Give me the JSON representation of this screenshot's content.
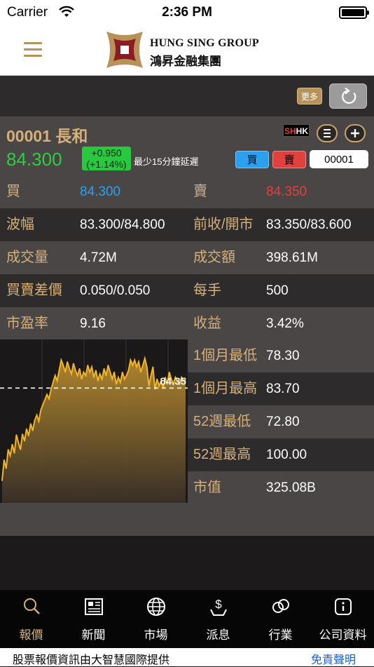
{
  "status_bar": {
    "carrier": "Carrier",
    "time": "2:36 PM"
  },
  "header": {
    "brand_en": "HUNG SING GROUP",
    "brand_zh": "鴻昇金融集團"
  },
  "toolbar": {
    "more_label": "更多"
  },
  "quote": {
    "code_name": "00001  長和",
    "price": "84.300",
    "change": "+0.950",
    "change_pct": "(+1.14%)",
    "delay_note": "最少15分鐘延遲",
    "shhk_badge": "SHHK",
    "buy_label": "買",
    "sell_label": "賣",
    "code_value": "00001",
    "price_color": "#2ecc40",
    "change_bg": "#27c93f"
  },
  "stats": {
    "rows": [
      {
        "label_l": "買",
        "value_l": "84.300",
        "label_r": "賣",
        "value_r": "84.350"
      },
      {
        "label_l": "波幅",
        "value_l": "83.300/84.800",
        "label_r": "前收/開市",
        "value_r": "83.350/83.600"
      },
      {
        "label_l": "成交量",
        "value_l": "4.72M",
        "label_r": "成交額",
        "value_r": "398.61M"
      },
      {
        "label_l": "買賣差價",
        "value_l": "0.050/0.050",
        "label_r": "每手",
        "value_r": "500"
      },
      {
        "label_l": "市盈率",
        "value_l": "9.16",
        "label_r": "收益",
        "value_r": "3.42%"
      }
    ],
    "buy_color": "#2aa0ef",
    "sell_color": "#e0403e",
    "side": [
      {
        "label": "1個月最低",
        "value": "78.30"
      },
      {
        "label": "1個月最高",
        "value": "83.70"
      },
      {
        "label": "52週最低",
        "value": "72.80"
      },
      {
        "label": "52週最高",
        "value": "100.00"
      },
      {
        "label": "市值",
        "value": "325.08B"
      }
    ]
  },
  "chart_data": {
    "type": "area",
    "ref_label": "84.35",
    "line_color": "#f0b429",
    "values": [
      73.6,
      76.0,
      75.0,
      77.2,
      76.5,
      77.8,
      76.8,
      78.9,
      78.0,
      77.2,
      79.0,
      78.2,
      79.6,
      78.8,
      80.2,
      79.4,
      80.6,
      81.2,
      80.5,
      81.8,
      82.4,
      83.0,
      83.6,
      83.1,
      84.2,
      85.0,
      85.8,
      85.2,
      86.4,
      87.6,
      87.0,
      86.2,
      87.4,
      86.6,
      86.0,
      87.2,
      86.4,
      85.8,
      86.6,
      85.4,
      86.2,
      85.8,
      87.0,
      86.2,
      86.8,
      85.6,
      86.4,
      85.2,
      86.0,
      85.4,
      86.6,
      85.8,
      87.0,
      86.2,
      85.4,
      86.2,
      84.8,
      85.6,
      85.0,
      86.2,
      85.4,
      85.8,
      86.4,
      87.6,
      87.0,
      87.6,
      86.8,
      87.4,
      86.2,
      87.0,
      87.8,
      86.8,
      84.6,
      85.8,
      86.8,
      84.2,
      85.4,
      84.6,
      85.2,
      84.4,
      85.6,
      84.8,
      86.2,
      85.4,
      84.8,
      85.6,
      85.2,
      84.8,
      85.6,
      85.2,
      85.4
    ],
    "ref_value": 84.35,
    "ylim": [
      71.0,
      90.0
    ]
  },
  "tabs": [
    {
      "label": "報價",
      "icon": "search-icon",
      "active": true
    },
    {
      "label": "新聞",
      "icon": "newspaper-icon",
      "active": false
    },
    {
      "label": "市場",
      "icon": "globe-icon",
      "active": false
    },
    {
      "label": "派息",
      "icon": "dividend-icon",
      "active": false
    },
    {
      "label": "行業",
      "icon": "industry-icon",
      "active": false
    },
    {
      "label": "公司資料",
      "icon": "info-icon",
      "active": false
    }
  ],
  "footer": {
    "text": "股票報價資訊由大智慧國際提供",
    "disclaimer": "免責聲明"
  }
}
